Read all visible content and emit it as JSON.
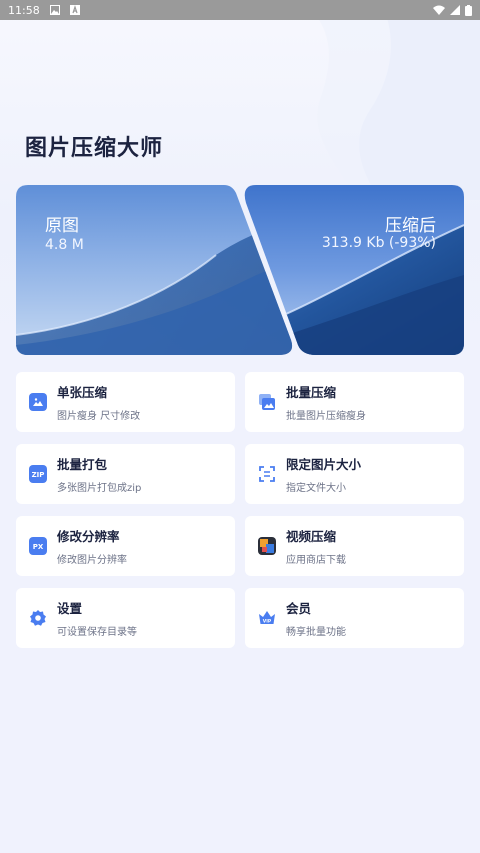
{
  "status_bar": {
    "time": "11:58",
    "icons": [
      "image-icon",
      "notification-a-icon",
      "wifi-icon",
      "signal-icon",
      "battery-icon"
    ]
  },
  "app": {
    "title": "图片压缩大师"
  },
  "hero": {
    "original_label": "原图",
    "original_size": "4.8 M",
    "compressed_label": "压缩后",
    "compressed_size": "313.9 Kb (-93%)"
  },
  "features": [
    {
      "title": "单张压缩",
      "subtitle": "图片瘦身 尺寸修改",
      "icon": "single-image-icon"
    },
    {
      "title": "批量压缩",
      "subtitle": "批量图片压缩瘦身",
      "icon": "multi-image-icon"
    },
    {
      "title": "批量打包",
      "subtitle": "多张图片打包成zip",
      "icon": "zip-icon"
    },
    {
      "title": "限定图片大小",
      "subtitle": "指定文件大小",
      "icon": "size-limit-icon"
    },
    {
      "title": "修改分辨率",
      "subtitle": "修改图片分辨率",
      "icon": "px-icon"
    },
    {
      "title": "视频压缩",
      "subtitle": "应用商店下载",
      "icon": "video-app-icon"
    },
    {
      "title": "设置",
      "subtitle": "可设置保存目录等",
      "icon": "gear-icon"
    },
    {
      "title": "会员",
      "subtitle": "畅享批量功能",
      "icon": "vip-crown-icon"
    }
  ],
  "colors": {
    "accent": "#4a7df0",
    "background": "#f0f2fd",
    "status_bar": "#9a9a9a"
  }
}
